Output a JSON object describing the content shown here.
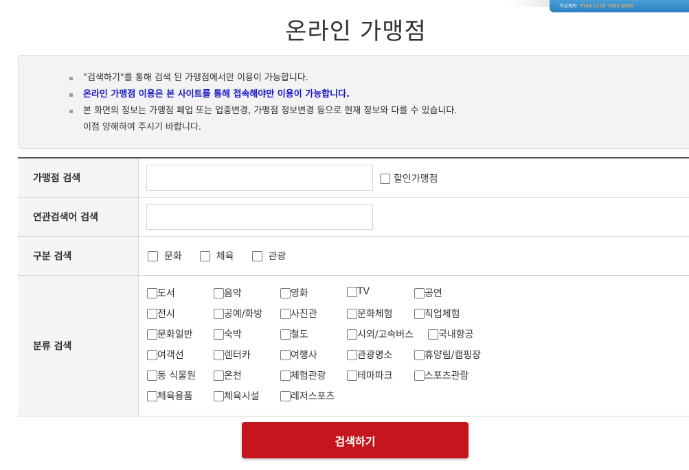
{
  "banner": {
    "label": "가상계좌",
    "number": "7348 0100 7463 8686"
  },
  "title": "온라인 가맹점",
  "notice": {
    "items": [
      {
        "text": "\"검색하기\"를 통해 검색 된 가맹점에서만 이용이 가능합니다."
      },
      {
        "text": "온라인 가맹점 이용은 본 사이트를 통해 접속해야만 이용이 가능합니다."
      },
      {
        "text": "본 화면의 정보는 가맹점 폐업 또는 업종변경, 가맹점 정보변경 등으로 현재 정보와 다를 수 있습니다.",
        "text2": "이점 양해하여 주시기 바랍니다."
      }
    ]
  },
  "form": {
    "store_search": {
      "label": "가맹점 검색",
      "value": "",
      "discount_label": "할인가맹점"
    },
    "keyword_search": {
      "label": "연관검색어 검색",
      "value": ""
    },
    "category_search": {
      "label": "구분 검색",
      "options": [
        "문화",
        "체육",
        "관광"
      ]
    },
    "classify_search": {
      "label": "분류 검색",
      "rows": [
        [
          "도서",
          "음악",
          "영화",
          "TV",
          "공연"
        ],
        [
          "전시",
          "공예/화방",
          "사진관",
          "문화체험",
          "직업체험"
        ],
        [
          "문화일반",
          "숙박",
          "철도",
          "시외/고속버스",
          "국내항공"
        ],
        [
          "여객선",
          "렌터카",
          "여행사",
          "관광명소",
          "휴양림/캠핑장"
        ],
        [
          "동 식물원",
          "온천",
          "체험관광",
          "테마파크",
          "스포츠관람"
        ],
        [
          "체육용품",
          "체육시설",
          "레저스포츠"
        ]
      ]
    }
  },
  "search_button": "검색하기"
}
